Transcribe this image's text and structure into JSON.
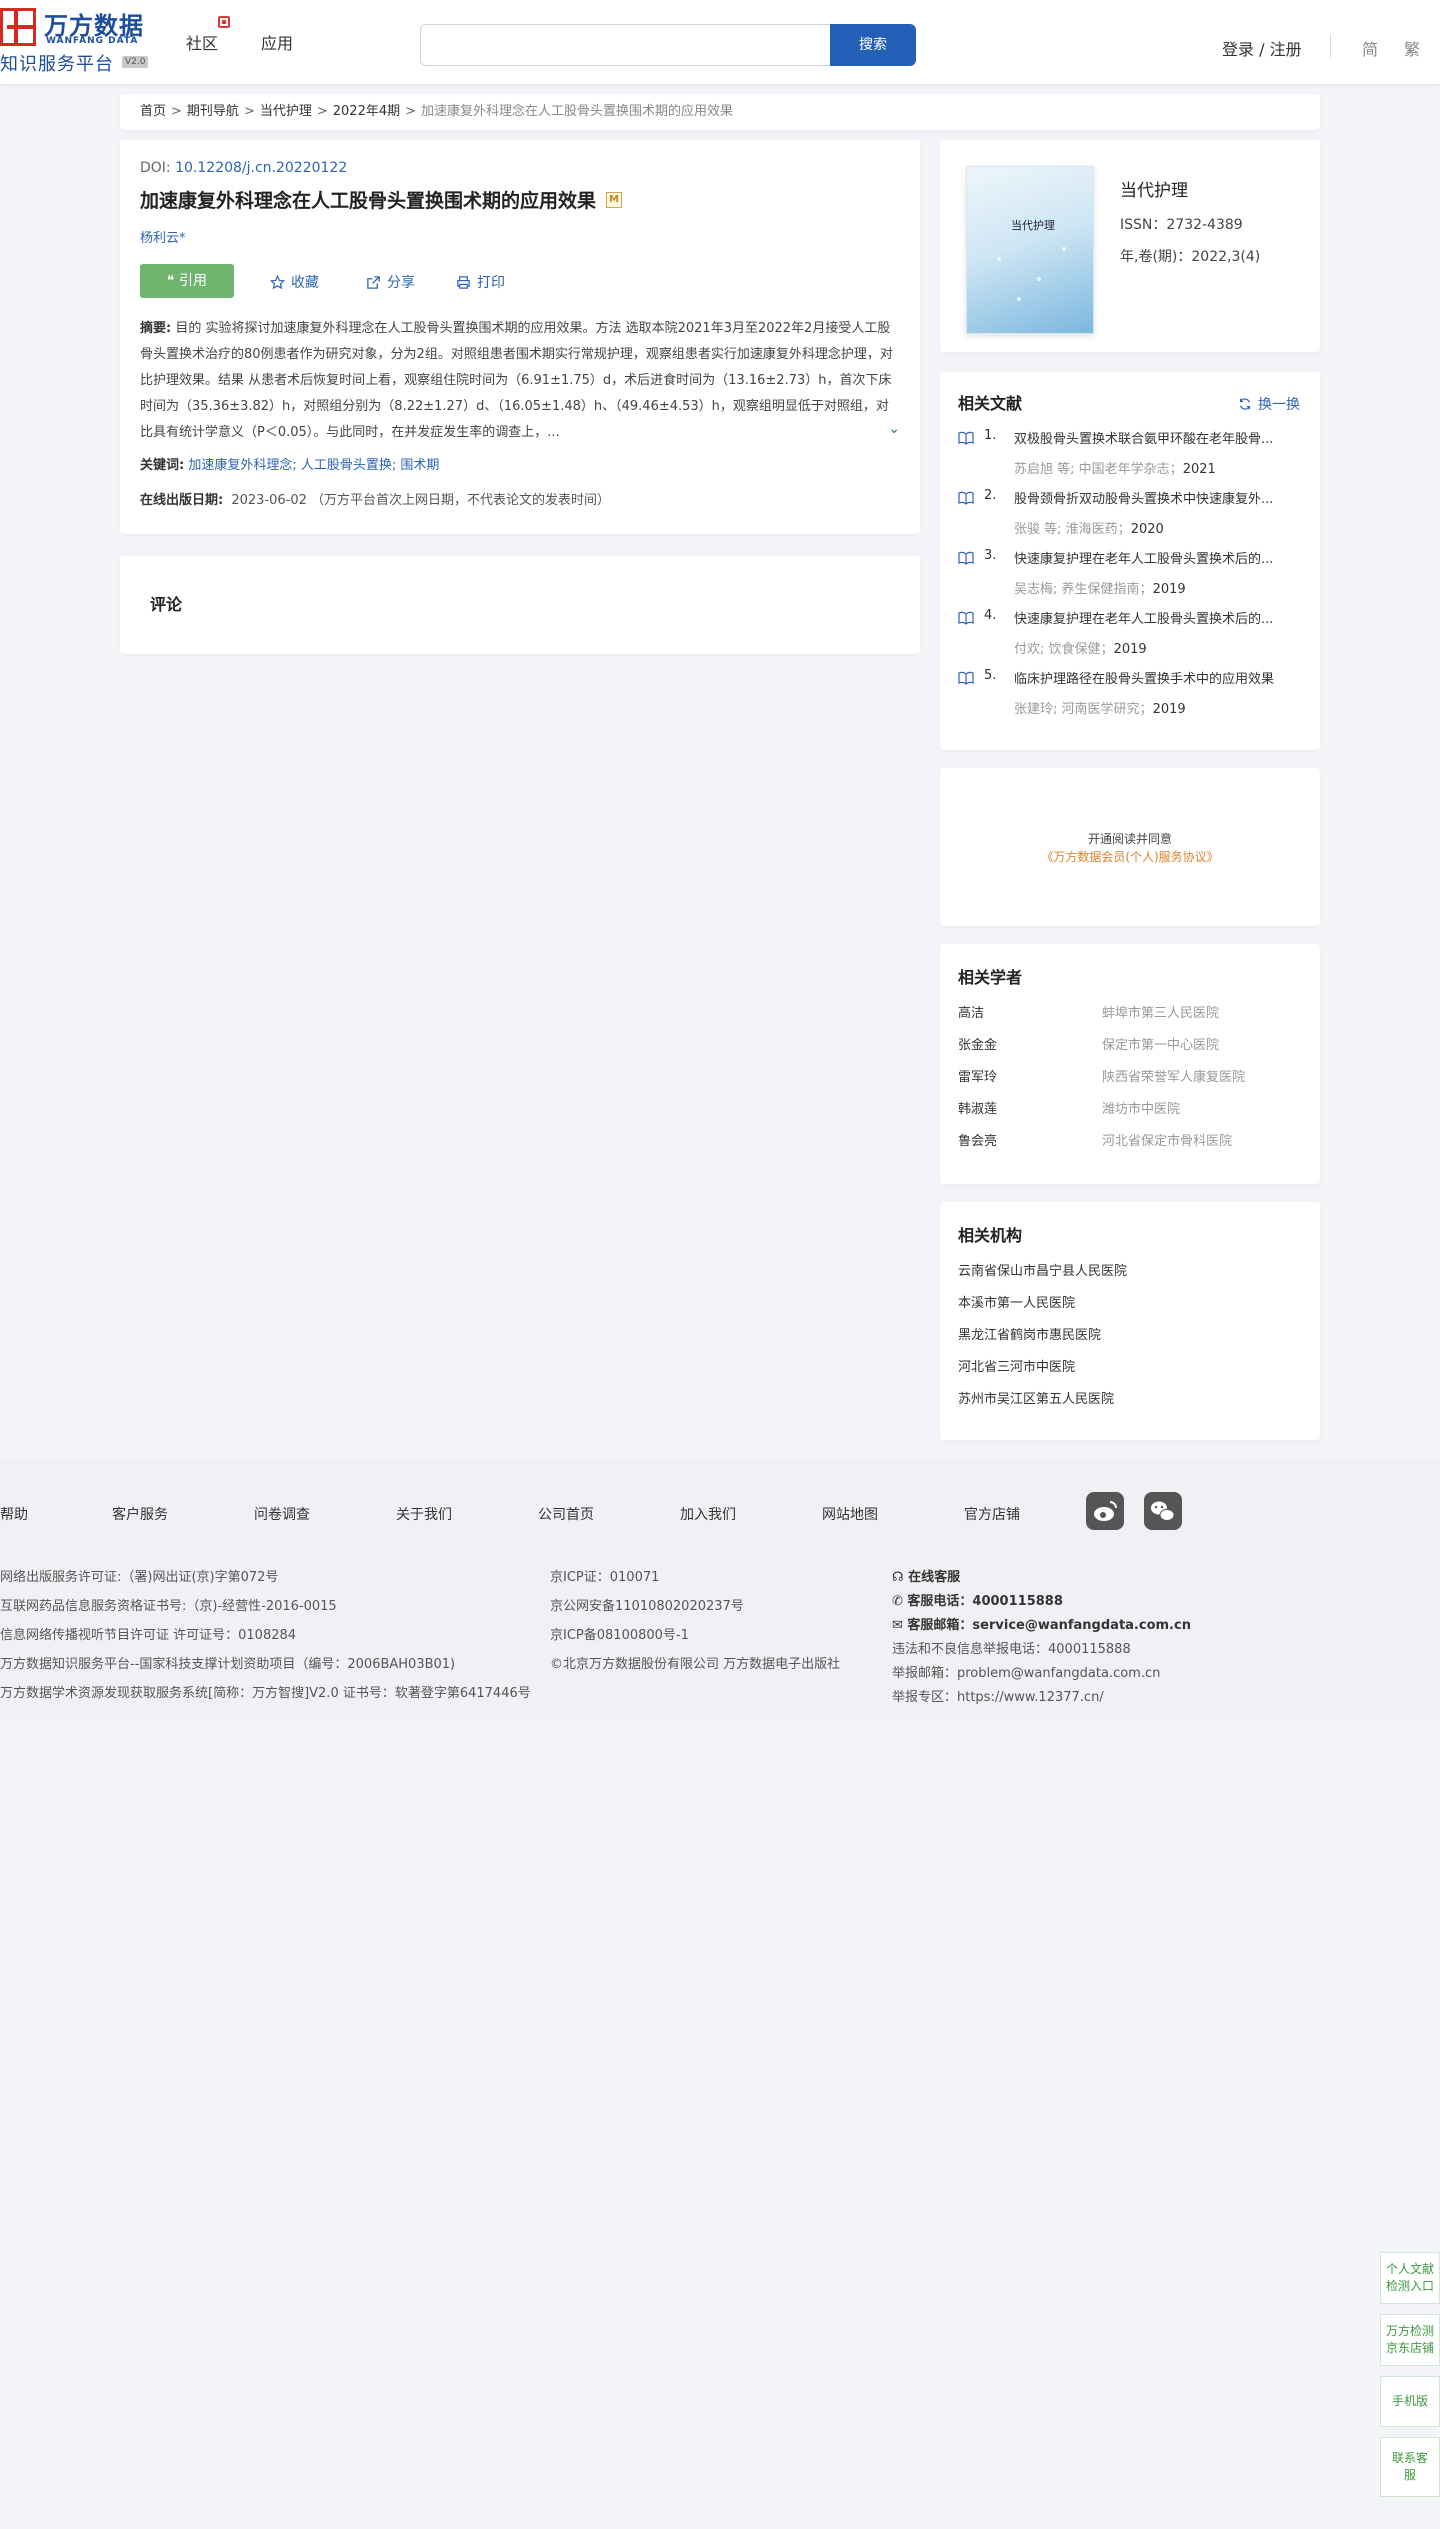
{
  "header": {
    "logo_cn": "万方数据",
    "logo_en": "WANFANG DATA",
    "logo_sub": "知识服务平台",
    "logo_version": "V2.0",
    "nav": [
      "社区",
      "应用"
    ],
    "search_value": "",
    "search_button": "搜索",
    "login": "登录 / 注册",
    "lang_simplified": "简",
    "lang_traditional": "繁"
  },
  "breadcrumb": {
    "items": [
      "首页",
      "期刊导航",
      "当代护理",
      "2022年4期"
    ],
    "current": "加速康复外科理念在人工股骨头置换围术期的应用效果",
    "separator": ">"
  },
  "article": {
    "doi_label": "DOI:",
    "doi": "10.12208/j.cn.20220122",
    "title": "加速康复外科理念在人工股骨头置换围术期的应用效果",
    "title_badge": "M",
    "author": "杨利云*",
    "actions": {
      "cite": "引用",
      "favorite": "收藏",
      "share": "分享",
      "print": "打印"
    },
    "abstract_label": "摘要:",
    "abstract": "目的 实验将探讨加速康复外科理念在人工股骨头置换围术期的应用效果。方法 选取本院2021年3月至2022年2月接受人工股骨头置换术治疗的80例患者作为研究对象，分为2组。对照组患者围术期实行常规护理，观察组患者实行加速康复外科理念护理，对比护理效果。结果 从患者术后恢复时间上看，观察组住院时间为（6.91±1.75）d，术后进食时间为（13.16±2.73）h，首次下床时间为（35.36±3.82）h，对照组分别为（8.22±1.27）d、（16.05±1.48）h、（49.46±4.53）h，观察组明显低于对照组，对比具有统计学意义（P＜0.05）。与此同时，在并发症发生率的调查上，...",
    "keywords_label": "关键词:",
    "keywords": "加速康复外科理念; 人工股骨头置换; 围术期",
    "pubdate_label": "在线出版日期:",
    "pubdate": "2023-06-02 （万方平台首次上网日期，不代表论文的发表时间）"
  },
  "comment": {
    "title": "评论"
  },
  "journal": {
    "cover_title": "当代护理",
    "name": "当代护理",
    "issn": "ISSN：2732-4389",
    "volume": "年,卷(期)：2022,3(4)"
  },
  "related_docs": {
    "title": "相关文献",
    "refresh": "换一换",
    "items": [
      {
        "num": "1.",
        "title": "双极股骨头置换术联合氨甲环酸在老年股骨...",
        "authors": "苏启旭 等;",
        "source": "中国老年学杂志",
        "year": "2021"
      },
      {
        "num": "2.",
        "title": "股骨颈骨折双动股骨头置换术中快速康复外...",
        "authors": "张骏 等;",
        "source": "淮海医药",
        "year": "2020"
      },
      {
        "num": "3.",
        "title": "快速康复护理在老年人工股骨头置换术后的...",
        "authors": "吴志梅;",
        "source": "养生保健指南",
        "year": "2019"
      },
      {
        "num": "4.",
        "title": "快速康复护理在老年人工股骨头置换术后的...",
        "authors": "付欢;",
        "source": "饮食保健",
        "year": "2019"
      },
      {
        "num": "5.",
        "title": "临床护理路径在股骨头置换手术中的应用效果",
        "authors": "张建玲;",
        "source": "河南医学研究",
        "year": "2019"
      }
    ]
  },
  "ad": {
    "line1": "开通阅读并同意",
    "line2": "《万方数据会员(个人)服务协议》"
  },
  "scholars": {
    "title": "相关学者",
    "items": [
      {
        "name": "高洁",
        "inst": "蚌埠市第三人民医院"
      },
      {
        "name": "张金金",
        "inst": "保定市第一中心医院"
      },
      {
        "name": "雷军玲",
        "inst": "陕西省荣誉军人康复医院"
      },
      {
        "name": "韩淑莲",
        "inst": "潍坊市中医院"
      },
      {
        "name": "鲁会亮",
        "inst": "河北省保定市骨科医院"
      }
    ]
  },
  "orgs": {
    "title": "相关机构",
    "items": [
      "云南省保山市昌宁县人民医院",
      "本溪市第一人民医院",
      "黑龙江省鹤岗市惠民医院",
      "河北省三河市中医院",
      "苏州市吴江区第五人民医院"
    ]
  },
  "footer": {
    "links": [
      "帮助",
      "客户服务",
      "问卷调查",
      "关于我们",
      "公司首页",
      "加入我们",
      "网站地图",
      "官方店铺"
    ],
    "col1": [
      "网络出版服务许可证:（署)网出证(京)字第072号",
      "互联网药品信息服务资格证书号:（京)-经营性-2016-0015",
      "信息网络传播视听节目许可证 许可证号：0108284",
      "万方数据知识服务平台--国家科技支撑计划资助项目（编号：2006BAH03B01)",
      "万方数据学术资源发现获取服务系统[简称：万方智搜]V2.0 证书号：软著登字第6417446号"
    ],
    "col2": [
      "京ICP证：010071",
      "京公网安备11010802020237号",
      "京ICP备08100800号-1",
      "©北京万方数据股份有限公司 万方数据电子出版社"
    ],
    "online_service": "在线客服",
    "phone": "客服电话：4000115888",
    "email": "客服邮箱：service@wanfangdata.com.cn",
    "report_phone": "违法和不良信息举报电话：4000115888",
    "report_email": "举报邮箱：problem@wanfangdata.com.cn",
    "report_area": "举报专区：https://www.12377.cn/"
  },
  "float_bar": [
    "个人文献检测入口",
    "万方检测京东店铺",
    "手机版",
    "联系客服"
  ]
}
